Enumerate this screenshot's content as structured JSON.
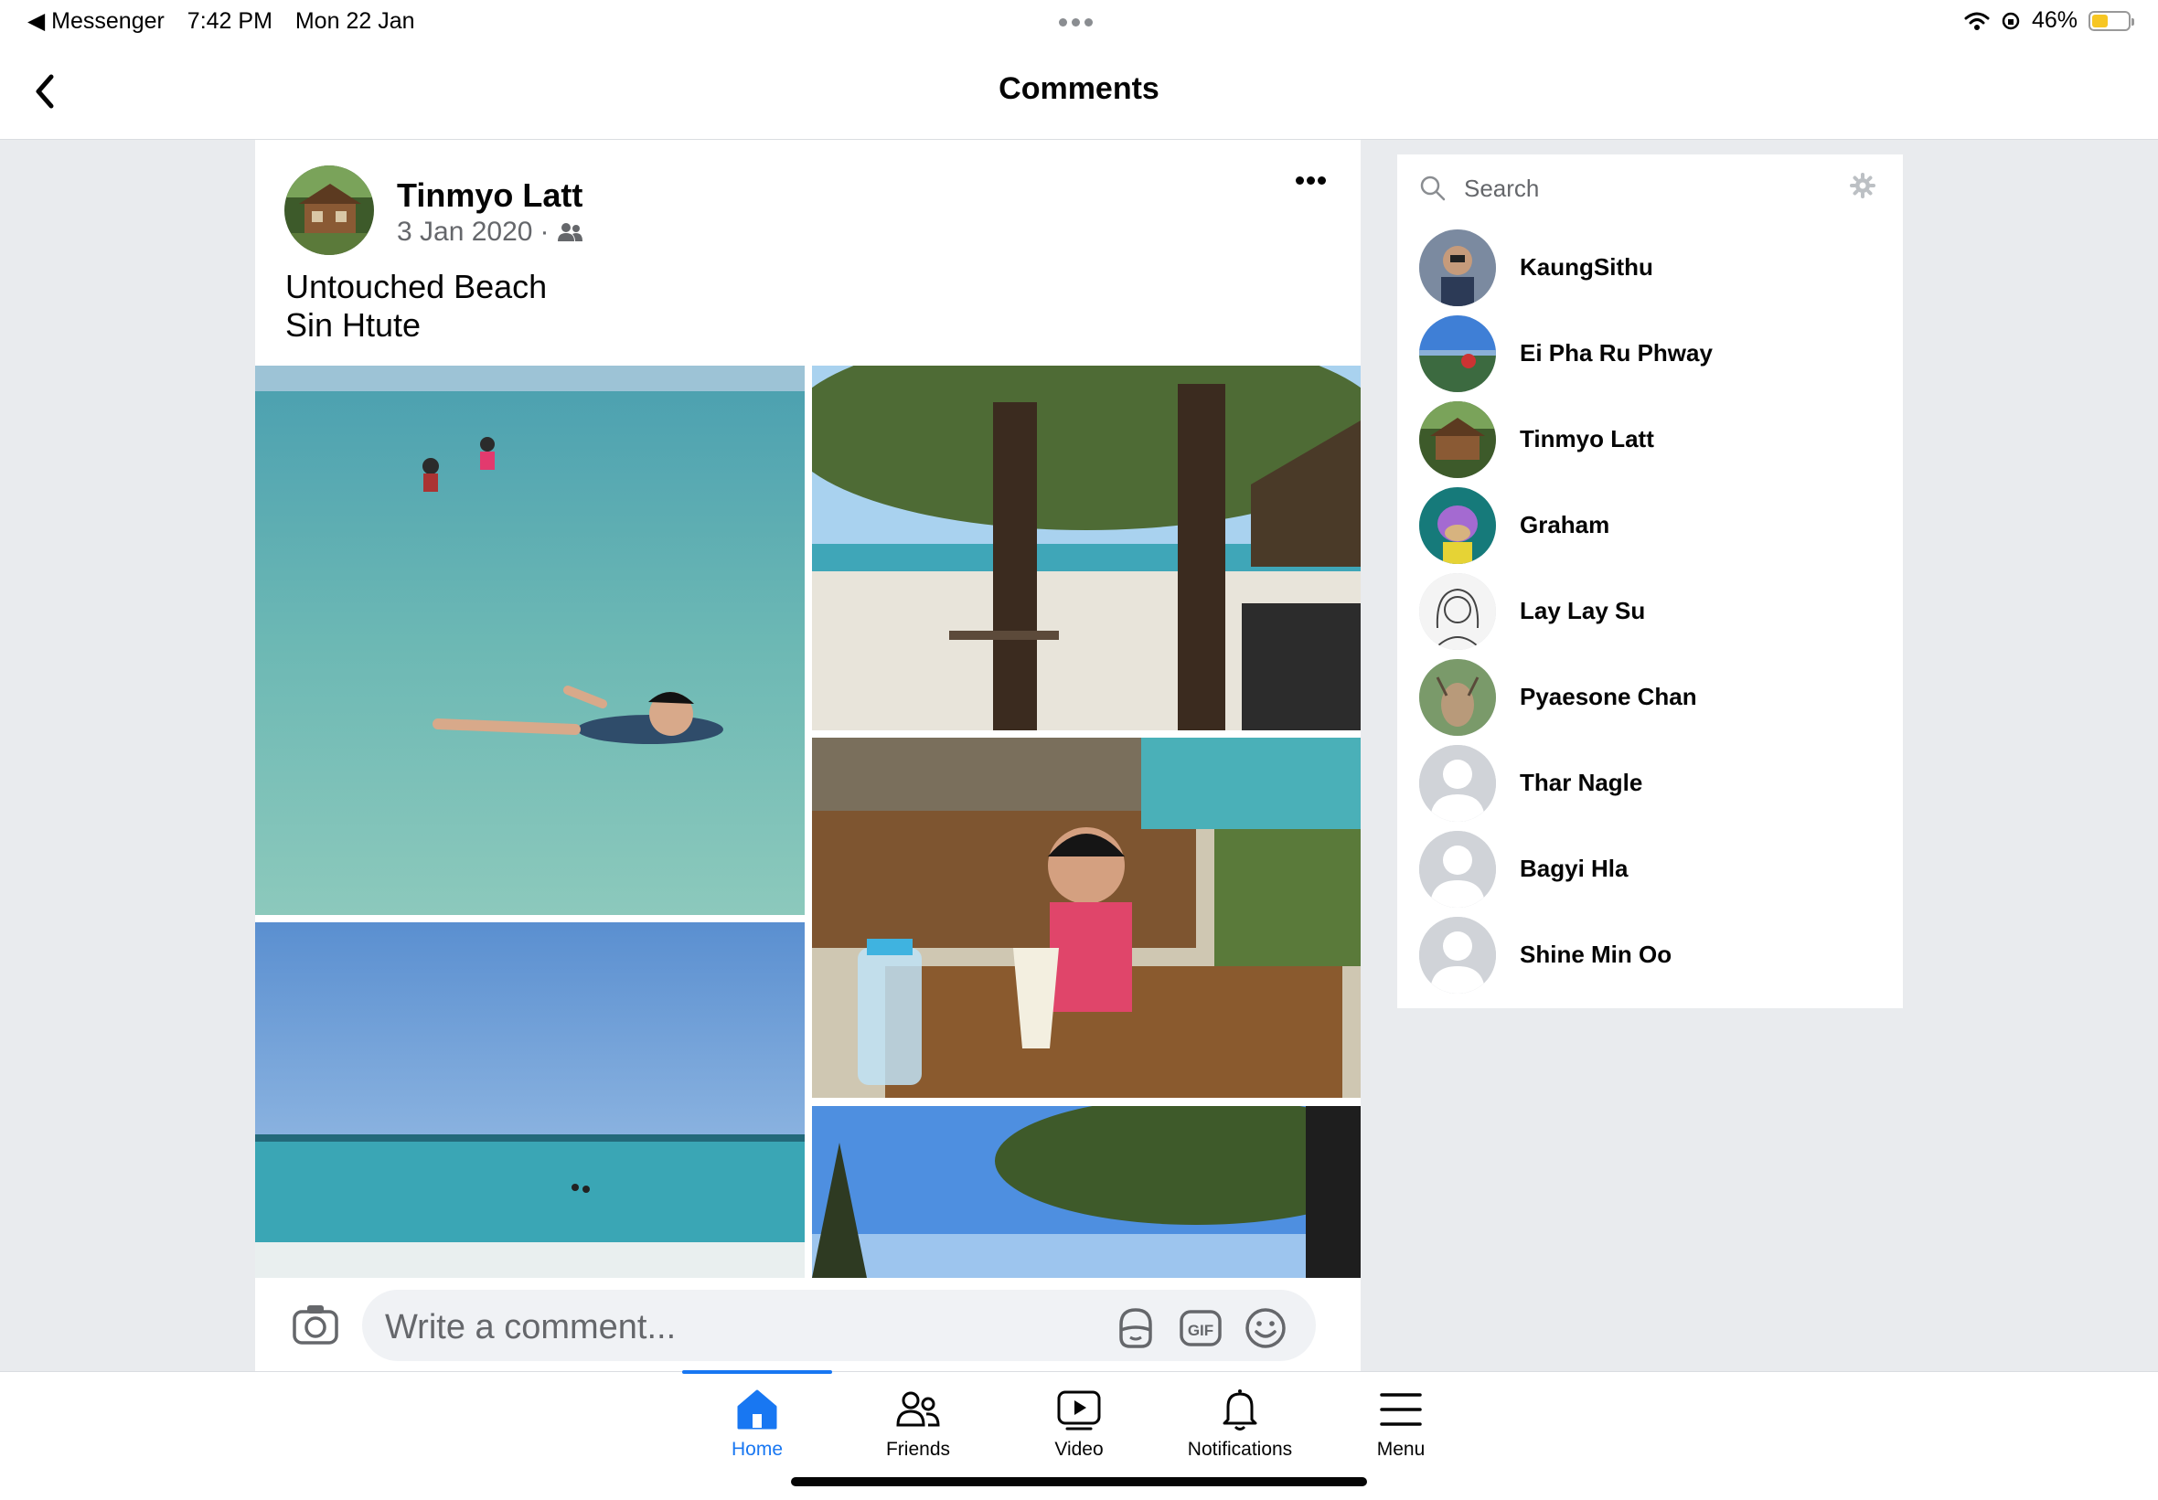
{
  "status_bar": {
    "back_app": "◀ Messenger",
    "time": "7:42 PM",
    "date": "Mon 22 Jan",
    "battery": "46%",
    "battery_level": 0.46
  },
  "header": {
    "title": "Comments"
  },
  "post": {
    "author": "Tinmyo Latt",
    "date": "3 Jan 2020",
    "separator": "·",
    "caption_line1": "Untouched Beach",
    "caption_line2": "Sin Htute"
  },
  "comment_bar": {
    "placeholder": "Write a comment..."
  },
  "sidebar": {
    "search_placeholder": "Search",
    "contacts": [
      {
        "name": "KaungSithu"
      },
      {
        "name": "Ei Pha Ru Phway"
      },
      {
        "name": "Tinmyo Latt"
      },
      {
        "name": "Graham"
      },
      {
        "name": "Lay Lay Su"
      },
      {
        "name": "Pyaesone Chan"
      },
      {
        "name": "Thar Nagle"
      },
      {
        "name": "Bagyi Hla"
      },
      {
        "name": "Shine Min Oo"
      }
    ]
  },
  "tabs": [
    {
      "label": "Home",
      "icon": "home-icon",
      "active": true
    },
    {
      "label": "Friends",
      "icon": "friends-icon"
    },
    {
      "label": "Video",
      "icon": "video-icon"
    },
    {
      "label": "Notifications",
      "icon": "bell-icon"
    },
    {
      "label": "Menu",
      "icon": "menu-icon"
    }
  ],
  "colors": {
    "accent": "#1877f2",
    "background": "#e9ebee",
    "secondary_text": "#65676b"
  }
}
